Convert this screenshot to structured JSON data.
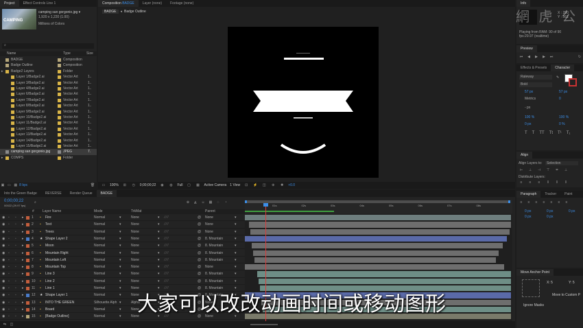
{
  "project": {
    "tab": "Project",
    "tab2": "Effect Controls Line 1",
    "file_name": "camping san gorgonio.jpg ▾",
    "file_size": "1,920 x 1,220 (1.00)",
    "file_colors": "Millions of Colors",
    "search_placeholder": "⌕",
    "col_name": "Name",
    "col_type": "Type",
    "col_size": "Size",
    "thumb_text": "CAMPING",
    "items": [
      {
        "name": "BADGE",
        "type": "Composition",
        "size": "",
        "indent": 0,
        "color": "#b5a67a"
      },
      {
        "name": "Badge Outline",
        "type": "Composition",
        "size": "",
        "indent": 0,
        "color": "#b5a67a"
      },
      {
        "name": "Badge2 Layers",
        "type": "Folder",
        "size": "",
        "indent": 0,
        "color": "#d9b548"
      },
      {
        "name": "Layer 1/Badge2.ai",
        "type": "Vector Art",
        "size": "1..",
        "indent": 1,
        "color": "#d9b548"
      },
      {
        "name": "Layer 3/Badge2.ai",
        "type": "Vector Art",
        "size": "1..",
        "indent": 1,
        "color": "#d9b548"
      },
      {
        "name": "Layer 4/Badge2.ai",
        "type": "Vector Art",
        "size": "1..",
        "indent": 1,
        "color": "#d9b548"
      },
      {
        "name": "Layer 6/Badge2.ai",
        "type": "Vector Art",
        "size": "1..",
        "indent": 1,
        "color": "#d9b548"
      },
      {
        "name": "Layer 7/Badge2.ai",
        "type": "Vector Art",
        "size": "1..",
        "indent": 1,
        "color": "#d9b548"
      },
      {
        "name": "Layer 8/Badge2.ai",
        "type": "Vector Art",
        "size": "1..",
        "indent": 1,
        "color": "#d9b548"
      },
      {
        "name": "Layer 9/Badge2.ai",
        "type": "Vector Art",
        "size": "1..",
        "indent": 1,
        "color": "#d9b548"
      },
      {
        "name": "Layer 10/Badge2.ai",
        "type": "Vector Art",
        "size": "1..",
        "indent": 1,
        "color": "#d9b548"
      },
      {
        "name": "Layer 11/Badge2.ai",
        "type": "Vector Art",
        "size": "1..",
        "indent": 1,
        "color": "#d9b548"
      },
      {
        "name": "Layer 12/Badge2.ai",
        "type": "Vector Art",
        "size": "1..",
        "indent": 1,
        "color": "#d9b548"
      },
      {
        "name": "Layer 13/Badge2.ai",
        "type": "Vector Art",
        "size": "1..",
        "indent": 1,
        "color": "#d9b548"
      },
      {
        "name": "Layer 14/Badge2.ai",
        "type": "Vector Art",
        "size": "1..",
        "indent": 1,
        "color": "#d9b548"
      },
      {
        "name": "Layer 15/Badge2.ai",
        "type": "Vector Art",
        "size": "1..",
        "indent": 1,
        "color": "#d9b548"
      },
      {
        "name": "camping san gorgonio.jpg",
        "type": "JPEG",
        "size": "7.",
        "indent": 0,
        "color": "#8a8a8a",
        "selected": true
      },
      {
        "name": "COMPS",
        "type": "Folder",
        "size": "",
        "indent": 0,
        "color": "#d9b548"
      }
    ],
    "bpc": "8 bpc"
  },
  "composition": {
    "tab": "Composition",
    "tab_comp": "BADGE",
    "tab_layer": "Layer (none)",
    "tab_footage": "Footage (none)",
    "breadcrumb_1": "BADGE",
    "breadcrumb_2": "Badge Outline",
    "zoom": "100%",
    "timecode": "0;00;00;22",
    "resolution": "Full",
    "camera": "Active Camera",
    "views": "1 View",
    "exposure": "+0.0"
  },
  "info": {
    "tab": "Info",
    "x": "X : 290",
    "y": "Y : 561",
    "status_1": "Playing from RAM: 90 of 90",
    "status_2": "fps:29.97 (realtime)"
  },
  "preview": {
    "tab": "Preview"
  },
  "character": {
    "tab_effects": "Effects & Presets",
    "tab_char": "Character",
    "font": "Raleway",
    "style": "Bold",
    "size": "57 px",
    "leading": "57 px",
    "kerning": "Metrics",
    "tracking": "0",
    "stroke": "- px",
    "vscale": "100 %",
    "hscale": "100 %",
    "baseline": "0 px",
    "tsume": "0 %",
    "styles": [
      "T",
      "T",
      "TT",
      "Tt",
      "T¹",
      "T₁"
    ]
  },
  "align": {
    "tab": "Align",
    "align_to_label": "Align Layers to:",
    "align_to_value": "Selection",
    "distribute_label": "Distribute Layers:"
  },
  "paragraph": {
    "tab": "Paragraph",
    "tab2": "Tracker",
    "tab3": "Paint",
    "v1": "0 px",
    "v2": "0 px",
    "v3": "0 px",
    "v4": "0 px",
    "v5": "0 px"
  },
  "anchor": {
    "tab": "Move Anchor Point",
    "x": "X: 5",
    "y": "Y: 5",
    "button": "Move to Custom P",
    "ignore": "Ignore Masks"
  },
  "timeline": {
    "tabs": [
      "Into the Green Badge",
      "REVERSE",
      "Render Queue",
      "BADGE"
    ],
    "timecode": "0;00;00;22",
    "fps": "00022 (29.97 fps)",
    "col_num": "#",
    "col_name": "Layer Name",
    "col_mode": "Mode",
    "col_trkmat": "TrkMat",
    "col_parent": "Parent",
    "ruler": [
      "01s",
      "02s",
      "03s",
      "04s",
      "05s",
      "06s",
      "07s",
      "08s"
    ],
    "layers": [
      {
        "num": "1",
        "name": "Fire",
        "mode": "Normal",
        "trk": "None",
        "parent": "None",
        "color": "#c35e3d",
        "star": false
      },
      {
        "num": "2",
        "name": "Text",
        "mode": "Normal",
        "trk": "None",
        "parent": "None",
        "color": "#c35e3d",
        "star": false
      },
      {
        "num": "3",
        "name": "Trees",
        "mode": "Normal",
        "trk": "None",
        "parent": "None",
        "color": "#c35e3d",
        "star": false
      },
      {
        "num": "4",
        "name": "Shape Layer 2",
        "mode": "Normal",
        "trk": "None",
        "parent": "8. Mountain",
        "color": "#4a7bc8",
        "star": true
      },
      {
        "num": "5",
        "name": "Moon",
        "mode": "Normal",
        "trk": "None",
        "parent": "8. Mountain",
        "color": "#c35e3d",
        "star": false
      },
      {
        "num": "6",
        "name": "Mountain Right",
        "mode": "Normal",
        "trk": "None",
        "parent": "8. Mountain",
        "color": "#c35e3d",
        "star": false
      },
      {
        "num": "7",
        "name": "Mountain Left",
        "mode": "Normal",
        "trk": "None",
        "parent": "8. Mountain",
        "color": "#c35e3d",
        "star": false
      },
      {
        "num": "8",
        "name": "Mountain Top",
        "mode": "Normal",
        "trk": "None",
        "parent": "None",
        "color": "#c35e3d",
        "star": false
      },
      {
        "num": "9",
        "name": "Line 3",
        "mode": "Normal",
        "trk": "None",
        "parent": "8. Mountain",
        "color": "#c35e3d",
        "star": false
      },
      {
        "num": "10",
        "name": "Line 2",
        "mode": "Normal",
        "trk": "None",
        "parent": "8. Mountain",
        "color": "#c35e3d",
        "star": false
      },
      {
        "num": "11",
        "name": "Line 1",
        "mode": "Normal",
        "trk": "None",
        "parent": "8. Mountain",
        "color": "#c35e3d",
        "star": false
      },
      {
        "num": "12",
        "name": "Shape Layer 1",
        "mode": "Normal",
        "trk": "None",
        "parent": "8. Mountain",
        "color": "#4a7bc8",
        "star": true
      },
      {
        "num": "13",
        "name": "INTO THE GREEN",
        "mode": "Silhouette Alph",
        "trk": "Alpha",
        "parent": "None",
        "color": "#c35e3d",
        "star": false
      },
      {
        "num": "14",
        "name": "Board",
        "mode": "Normal",
        "trk": "None",
        "parent": "None",
        "color": "#c35e3d",
        "star": false
      },
      {
        "num": "15",
        "name": "[Badge Outline]",
        "mode": "Normal",
        "trk": "None",
        "parent": "None",
        "color": "#b5a67a",
        "star": false
      }
    ]
  },
  "subtitle": "大家可以改改动画时间或移动图形",
  "watermark": "網 虎 公 开"
}
